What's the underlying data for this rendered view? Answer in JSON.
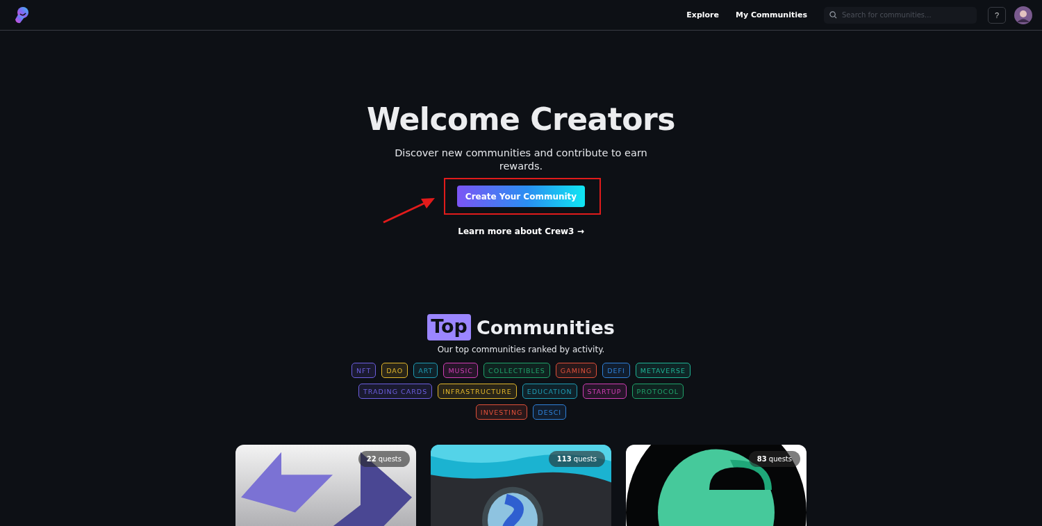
{
  "nav": {
    "links": [
      {
        "label": "Explore"
      },
      {
        "label": "My Communities"
      }
    ],
    "search": {
      "placeholder": "Search for communities..."
    },
    "help": "?"
  },
  "hero": {
    "title": "Welcome Creators",
    "subtitle": "Discover new communities and contribute to earn rewards.",
    "cta": "Create Your Community",
    "learn_more": "Learn more about Crew3 →"
  },
  "top": {
    "highlight": "Top",
    "title": "Communities",
    "subtitle": "Our top communities ranked by activity.",
    "tag_rows": [
      [
        {
          "label": "NFT",
          "color": "#6d5fe0"
        },
        {
          "label": "DAO",
          "color": "#e3b72b"
        },
        {
          "label": "ART",
          "color": "#1f9bb3"
        },
        {
          "label": "MUSIC",
          "color": "#d03fb4"
        },
        {
          "label": "COLLECTIBLES",
          "color": "#20a36a"
        },
        {
          "label": "GAMING",
          "color": "#e0503a"
        },
        {
          "label": "DEFI",
          "color": "#2f80d8"
        },
        {
          "label": "METAVERSE",
          "color": "#1fb596"
        }
      ],
      [
        {
          "label": "TRADING CARDS",
          "color": "#6d5fe0"
        },
        {
          "label": "INFRASTRUCTURE",
          "color": "#e3b72b"
        },
        {
          "label": "EDUCATION",
          "color": "#1f9bb3"
        },
        {
          "label": "STARTUP",
          "color": "#d03fb4"
        },
        {
          "label": "PROTOCOL",
          "color": "#20a36a"
        }
      ],
      [
        {
          "label": "INVESTING",
          "color": "#e0503a"
        },
        {
          "label": "DESCI",
          "color": "#2f80d8"
        }
      ]
    ],
    "cards": [
      {
        "quests": "**22** quests",
        "kind": "arrows"
      },
      {
        "quests": "**113** quests",
        "kind": "wave"
      },
      {
        "quests": "**83** quests",
        "kind": "circle"
      }
    ]
  }
}
